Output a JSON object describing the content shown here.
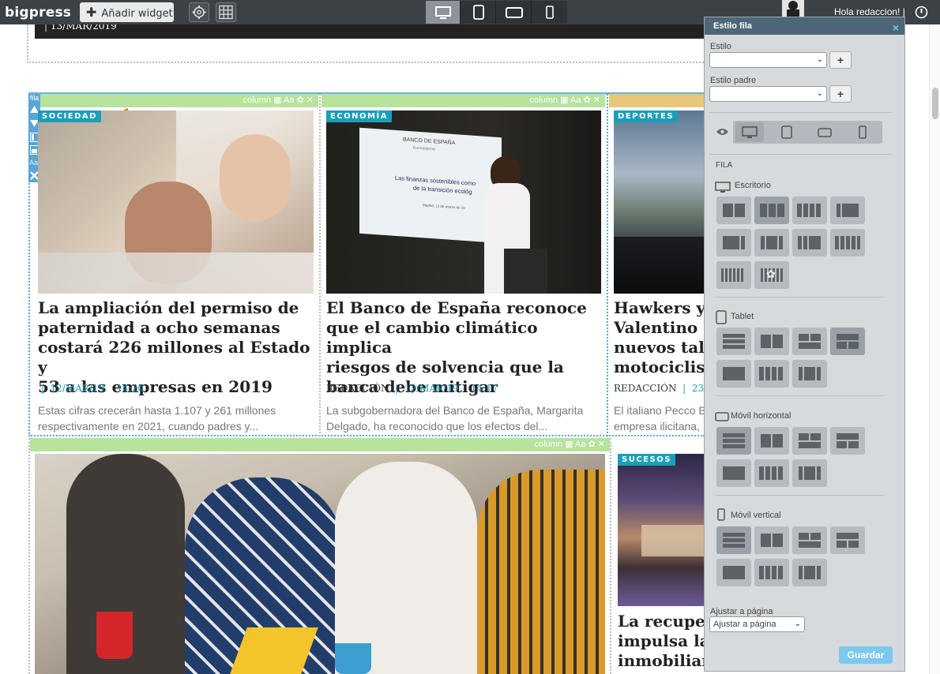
{
  "topbar": {
    "logo": "bigpress",
    "add_widget": "Añadir widget",
    "greeting": "Hola redaccion!",
    "separator": "|"
  },
  "prev_article": {
    "date": "13/MAR/2019"
  },
  "column_bar": {
    "label": "column",
    "font_label": "Aa"
  },
  "row_label": "fila",
  "articles": [
    {
      "badge": "SOCIEDAD",
      "title_lines": [
        "La ampliación del permiso de",
        "paternidad a ocho semanas",
        "costará 226 millones al Estado y",
        "53 a las empresas en 2019"
      ],
      "author": "",
      "date": "12/MAR/19",
      "time": "14:20",
      "excerpt_lines": [
        "Estas cifras crecerán hasta 1.107 y 261 millones",
        "respectivamente en 2021, cuando padres y..."
      ]
    },
    {
      "badge": "ECONOMÍA",
      "title_lines": [
        "El Banco de España reconoce",
        "que el cambio climático implica",
        "riesgos de solvencia que la",
        "banca debe mitigar"
      ],
      "author": "REDACCIÓN",
      "date": "12/MAR/19",
      "time": "14:17",
      "excerpt_lines": [
        "La subgobernadora del Banco de España, Margarita",
        "Delgado, ha reconocido que los efectos del..."
      ],
      "slide_text": [
        "BANCO DE ESPAÑA",
        "Eurosistema",
        "Las finanzas sostenibles como",
        "de la transición ecológ",
        "Madrid, 12 de marzo de 20"
      ]
    },
    {
      "badge": "DEPORTES",
      "title_lines": [
        "Hawkers y",
        "Valentino R",
        "nuevos tale",
        "motociclism"
      ],
      "author": "REDACCIÓN",
      "date": "23/M",
      "excerpt_lines": [
        "El italiano Pecco B",
        "empresa ilicitana,"
      ]
    },
    {
      "badge": "SUCESOS",
      "title_lines": [
        "La recuper",
        "impulsa la",
        "inmobiliar"
      ]
    }
  ],
  "panel": {
    "title": "Estilo fila",
    "close": "×",
    "estilo_label": "Estilo",
    "estilo_padre_label": "Estilo padre",
    "plus": "+",
    "section": "FILA",
    "escritorio": "Escritorio",
    "tablet": "Tablet",
    "movil_horizontal": "Móvil horizontal",
    "movil_vertical": "Móvil vertical",
    "ajustar_label": "Ajustar a página",
    "ajustar_value": "Ajustar a página",
    "save": "Guardar"
  }
}
